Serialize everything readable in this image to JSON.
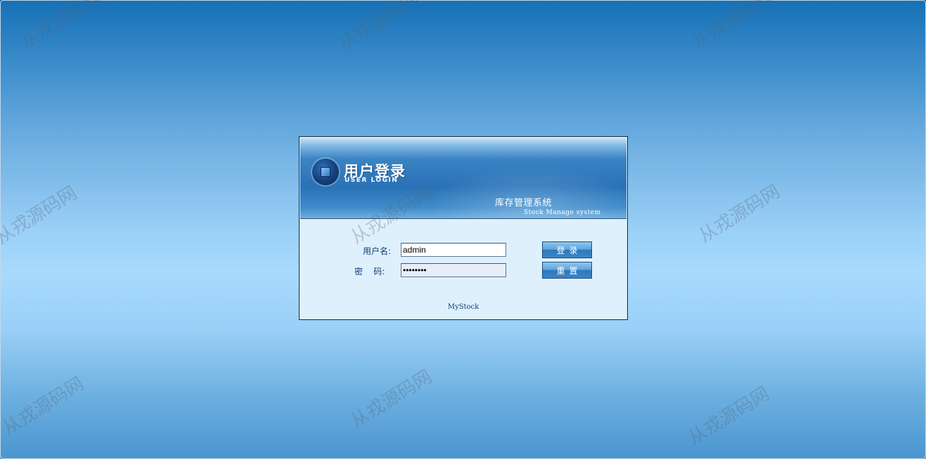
{
  "watermark": {
    "text": "从戎源码网"
  },
  "login": {
    "title": "用户登录",
    "subtitle": "USER LOGIN",
    "system_name": "库存管理系统",
    "system_name_en": "Stock Manage system",
    "username_label": "用户名:",
    "username_value": "admin",
    "password_label": "密    码:",
    "password_value": "••••••••",
    "login_button": "登录",
    "reset_button": "重置",
    "footer": "MyStock"
  },
  "icons": {
    "logo": "square-in-circle-logo-icon"
  },
  "colors": {
    "header_blue": "#2a72b6",
    "panel_background": "#dff0fd",
    "label_text": "#0e3f6e"
  }
}
